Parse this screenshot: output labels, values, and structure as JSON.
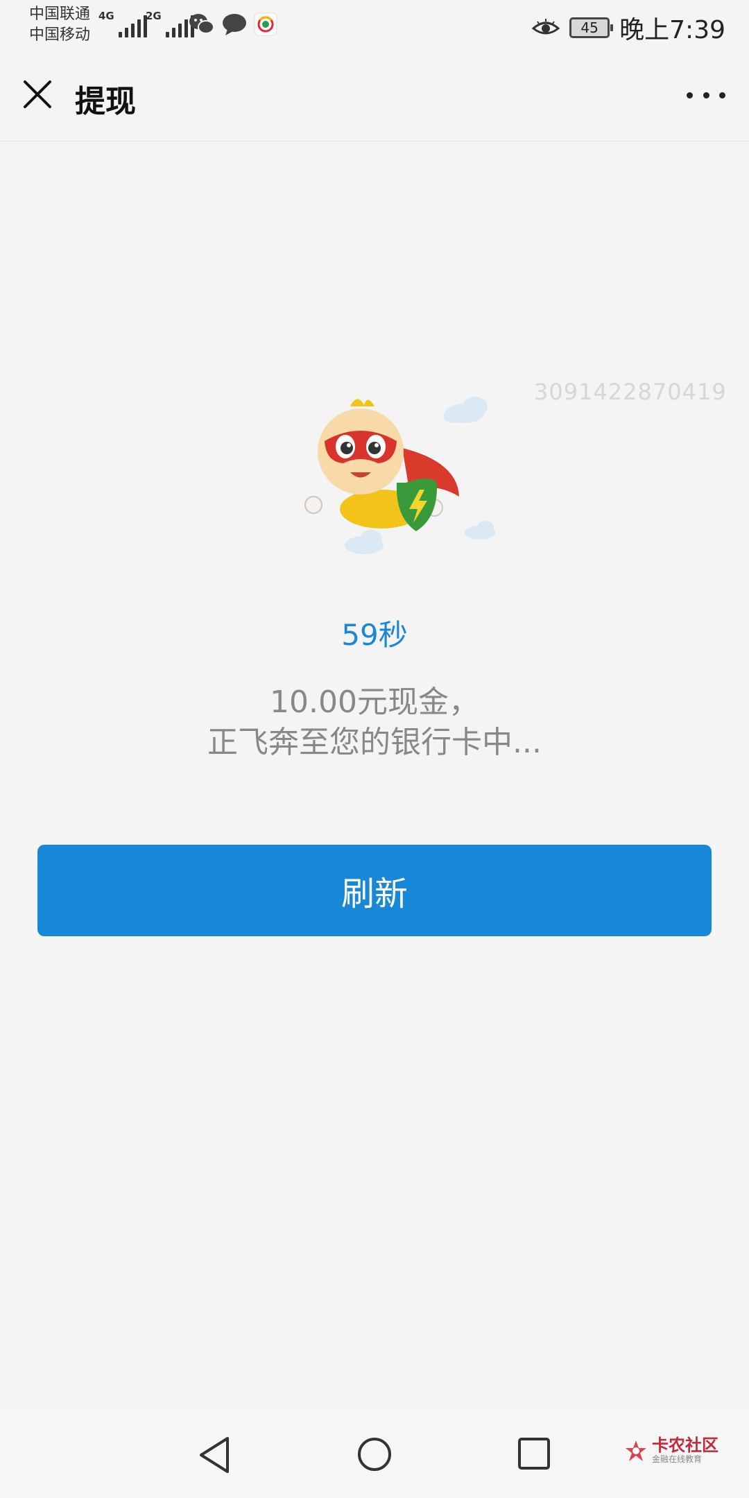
{
  "status": {
    "carrier1": "中国联通",
    "carrier2": "中国移动",
    "net1": "4G",
    "net2": "2G",
    "battery": "45",
    "time": "晚上7:39"
  },
  "nav": {
    "title": "提现"
  },
  "content": {
    "watermark": "3091422870419",
    "countdown": "59秒",
    "message_line1": "10.00元现金，",
    "message_line2": "正飞奔至您的银行卡中...",
    "refresh_label": "刷新"
  },
  "brand": {
    "name": "卡农社区",
    "tagline": "金融在线教育"
  },
  "colors": {
    "accent": "#1787d7",
    "countdown": "#1a87d6",
    "background": "#f4f4f4"
  }
}
